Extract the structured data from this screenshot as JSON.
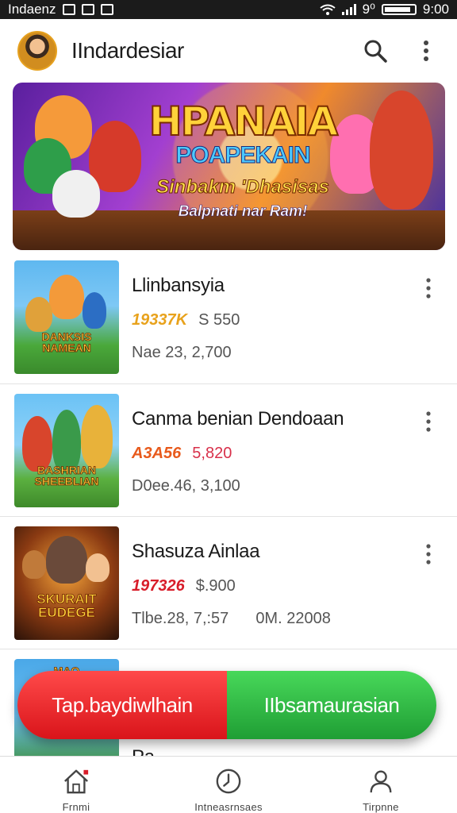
{
  "status_bar": {
    "carrier": "Indaenz",
    "time": "9:00",
    "battery_label": "9⁰"
  },
  "app_bar": {
    "title": "IIndardesiar"
  },
  "banner": {
    "title": "HPANAIA",
    "subtitle": "POAPEKAIN",
    "line3": "Sinbakm 'Dhasisas",
    "line4": "Balpnati nar Ram!"
  },
  "items": [
    {
      "name": "Llinbansyia",
      "price_a": "19337K",
      "price_b": "S 550",
      "meta_a": "Nae 23, 2,700",
      "meta_b": "",
      "thumb_text": "DANKSIS NAMEAN",
      "price_color": "#e8a21c"
    },
    {
      "name": "Canma benian Dendoaan",
      "price_a": "A3A56",
      "price_b": "5,820",
      "meta_a": "D0ee.46, 3,100",
      "meta_b": "",
      "thumb_text": "BASHRIAN SHEEBLIAN",
      "price_color": "#e85a1c"
    },
    {
      "name": "Shasuza Ainlaa",
      "price_a": "197326",
      "price_b": "$.900",
      "meta_a": "Tlbe.28, 7,:57",
      "meta_b": "0M. 22008",
      "thumb_text": "SKURAIT EUDEGE",
      "price_color": "#d81d2a"
    },
    {
      "name": "Pa",
      "price_a": "",
      "price_b": "",
      "meta_a": "",
      "meta_b": "",
      "thumb_text": "MAO",
      "price_color": "#d81d2a"
    }
  ],
  "cta": {
    "left_label": "Tap.baydiwlhain",
    "right_label": "IIbsamaurasian"
  },
  "bottom_nav": [
    {
      "label": "Frnmi",
      "icon": "home-icon"
    },
    {
      "label": "Intneasrnsaes",
      "icon": "clock-icon"
    },
    {
      "label": "Tirpnne",
      "icon": "profile-icon"
    }
  ]
}
